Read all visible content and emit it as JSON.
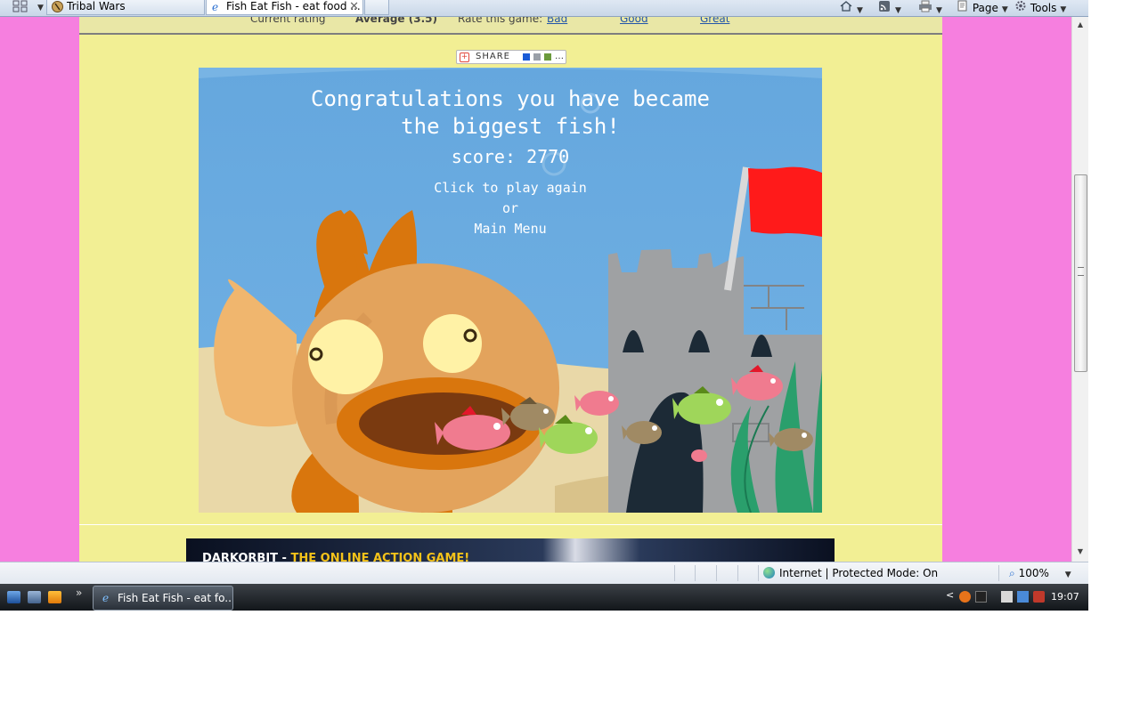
{
  "browser": {
    "tabs": [
      {
        "title": "Tribal Wars",
        "active": false
      },
      {
        "title": "Fish Eat Fish - eat food ...",
        "active": true
      }
    ],
    "tab_close_glyph": "✕",
    "commands": {
      "page": "Page",
      "tools": "Tools"
    }
  },
  "page": {
    "rating_strip": {
      "label": "Current rating",
      "value": "Average (3.5)",
      "rate_prompt": "Rate this game:",
      "options": [
        "Bad",
        "Good",
        "Great"
      ]
    },
    "share_button": {
      "label": "SHARE"
    },
    "game": {
      "title_line1": "Congratulations you have became",
      "title_line2": "the biggest fish!",
      "score_label": "score:",
      "score_value": "2770",
      "play_again": "Click to play again",
      "or": "or",
      "main_menu": "Main Menu"
    },
    "banner": {
      "part1": "DARKORBIT - ",
      "part2": "THE ONLINE ACTION GAME!"
    }
  },
  "statusbar": {
    "zone": "Internet | Protected Mode: On",
    "zoom": "100%"
  },
  "taskbar": {
    "active_window": "Fish Eat Fish - eat fo...",
    "clock": "19:07"
  },
  "colors": {
    "page_bg": "#f67fdf",
    "column_bg": "#f2ef94",
    "sea": "#6aace0",
    "sand": "#e8d7a8",
    "player_fish": "#e3a35c",
    "castle": "#9fa1a3",
    "flag": "#ff1a1a"
  }
}
